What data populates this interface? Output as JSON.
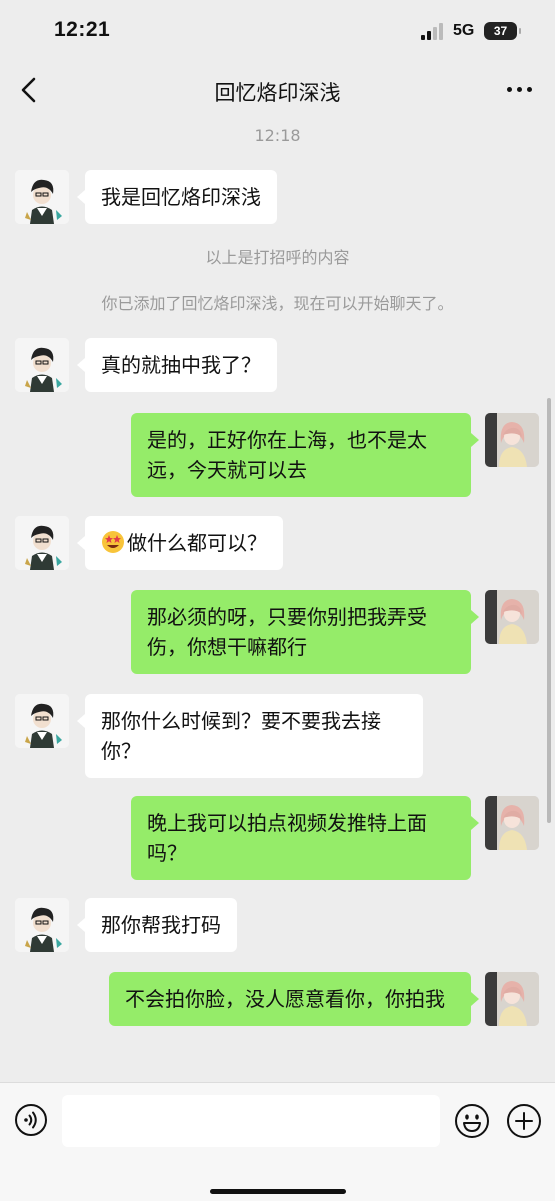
{
  "status_bar": {
    "time": "12:21",
    "network": "5G",
    "battery": "37"
  },
  "header": {
    "title": "回忆烙印深浅",
    "back_icon": "chevron-left-icon",
    "more_icon": "more-dots-icon"
  },
  "chat": {
    "timestamp": "12:18",
    "system_messages": [
      "以上是打招呼的内容",
      "你已添加了回忆烙印深浅，现在可以开始聊天了。"
    ],
    "messages": [
      {
        "side": "left",
        "text": "我是回忆烙印深浅"
      },
      {
        "side": "left",
        "text": "真的就抽中我了？"
      },
      {
        "side": "right",
        "text": "是的，正好你在上海，也不是太远，今天就可以去"
      },
      {
        "side": "left",
        "emoji": "star-struck-emoji",
        "text": "做什么都可以？"
      },
      {
        "side": "right",
        "text": "那必须的呀，只要你别把我弄受伤，你想干嘛都行"
      },
      {
        "side": "left",
        "text": "那你什么时候到？要不要我去接你？"
      },
      {
        "side": "right",
        "text": "晚上我可以拍点视频发推特上面吗？"
      },
      {
        "side": "left",
        "text": "那你帮我打码"
      },
      {
        "side": "right",
        "text": "不会拍你脸，没人愿意看你，你拍我"
      }
    ]
  },
  "input_bar": {
    "message_value": "",
    "icons": [
      "voice-icon",
      "emoji-smile-icon",
      "plus-icon"
    ]
  },
  "colors": {
    "background": "#ededed",
    "own_bubble": "#95ec69",
    "other_bubble": "#ffffff",
    "system_text": "#9a9a9a"
  }
}
